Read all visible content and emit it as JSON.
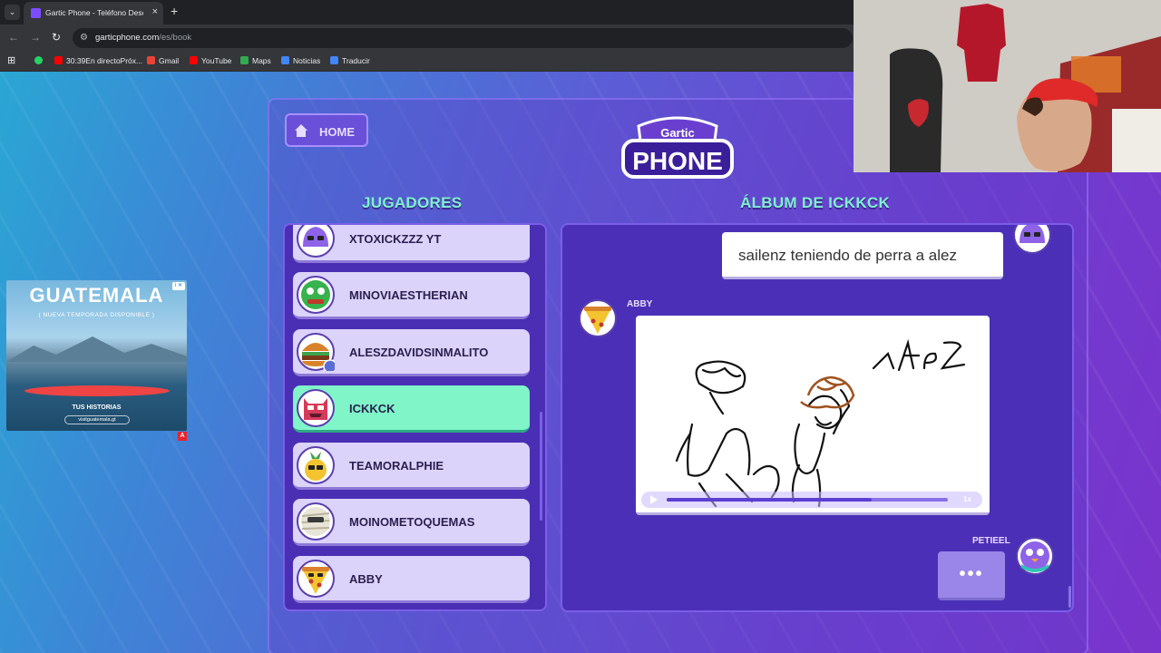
{
  "browser": {
    "tab_title": "Gartic Phone - Teléfono Descon",
    "url_host": "garticphone.com",
    "url_path": "/es/book",
    "bookmarks": [
      "30:39En directoPróx...",
      "Gmail",
      "YouTube",
      "Maps",
      "Noticias",
      "Traducir"
    ]
  },
  "ad": {
    "title": "GUATEMALA",
    "subtitle": "( NUEVA TEMPORADA DISPONIBLE )",
    "footer": "TUS HISTORIAS",
    "url": "visitguatemala.gt",
    "badge": "A"
  },
  "game": {
    "home_label": "HOME",
    "logo_top": "Gartic",
    "logo_bottom": "PHONE",
    "players_title": "JUGADORES",
    "album_title": "ÁLBUM DE ICKKCK",
    "players": [
      {
        "name": "XTOXICKZZZ YT",
        "active": false,
        "avatar": "purple-ghost-avatar"
      },
      {
        "name": "MINOVIAESTHERIAN",
        "active": false,
        "avatar": "green-monster-avatar"
      },
      {
        "name": "ALESZDAVIDSINMALITO",
        "active": false,
        "avatar": "burger-avatar"
      },
      {
        "name": "ICKKCK",
        "active": true,
        "avatar": "red-devil-avatar"
      },
      {
        "name": "TEAMORALPHIE",
        "active": false,
        "avatar": "pineapple-avatar"
      },
      {
        "name": "MOINOMETOQUEMAS",
        "active": false,
        "avatar": "mummy-avatar"
      },
      {
        "name": "ABBY",
        "active": false,
        "avatar": "pizza-avatar"
      }
    ],
    "album": {
      "caption": "sailenz teniendo de perra a alez",
      "drawing_author": "ABBY",
      "drawing_text": "ↆAlez",
      "playback_progress": 0.73,
      "speed": "1x",
      "next_author": "PETIEEL",
      "typing": "•••"
    }
  }
}
